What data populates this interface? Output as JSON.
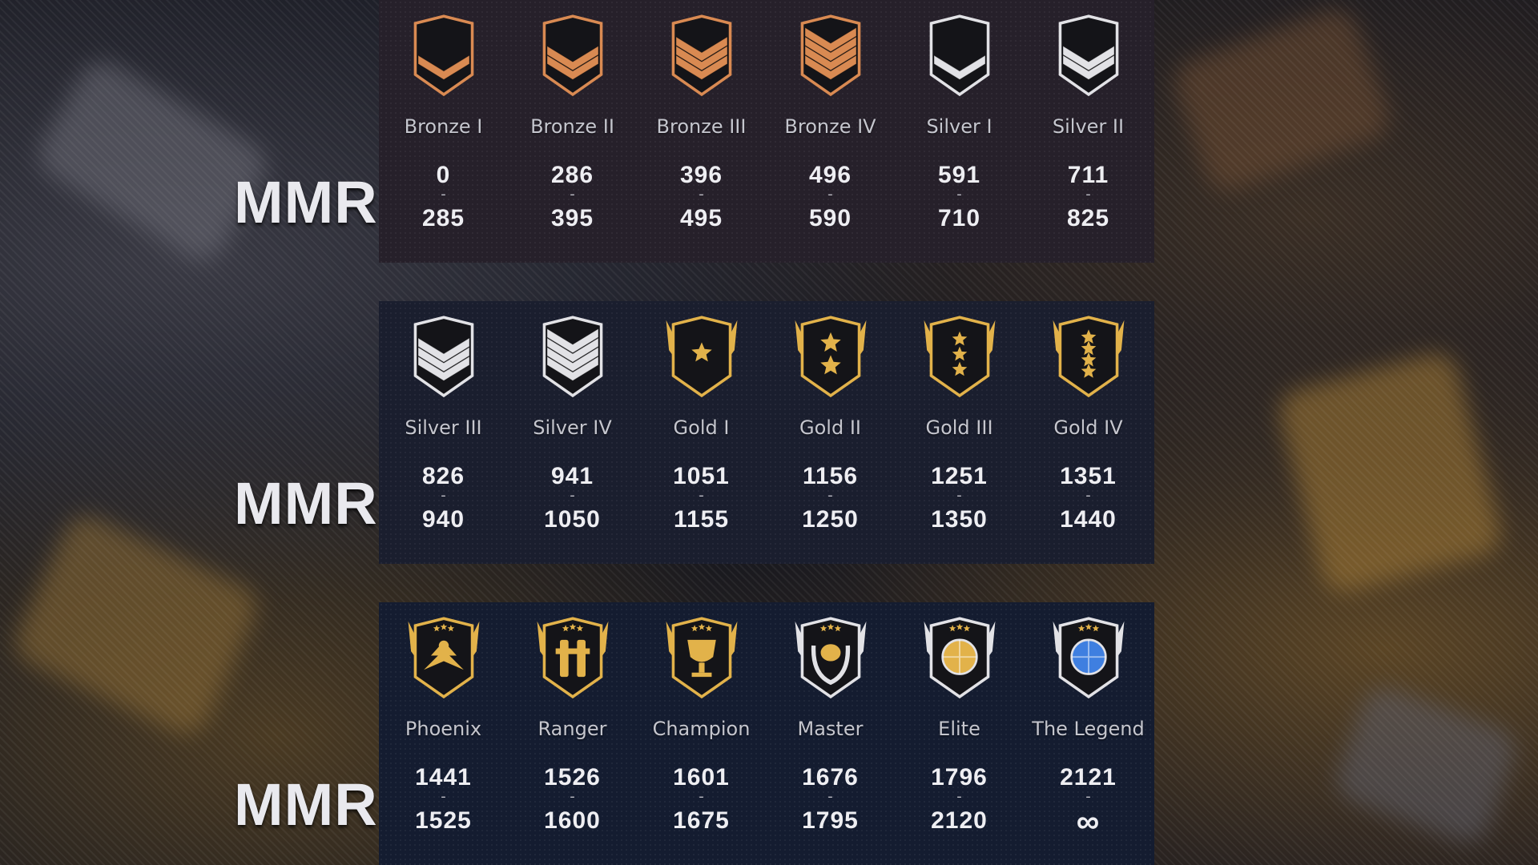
{
  "mmr_label": "MMR:",
  "range_separator": "-",
  "colors": {
    "bronze": "#d98a52",
    "silver": "#e2e2e6",
    "gold": "#e2b24a",
    "badge_dark": "#141418",
    "globe": "#3f7fe0"
  },
  "rows": [
    {
      "ranks": [
        {
          "name": "Bronze I",
          "min": "0",
          "max": "285",
          "icon": "bronze-chevron-1-icon"
        },
        {
          "name": "Bronze II",
          "min": "286",
          "max": "395",
          "icon": "bronze-chevron-2-icon"
        },
        {
          "name": "Bronze III",
          "min": "396",
          "max": "495",
          "icon": "bronze-chevron-3-icon"
        },
        {
          "name": "Bronze IV",
          "min": "496",
          "max": "590",
          "icon": "bronze-chevron-4-icon"
        },
        {
          "name": "Silver I",
          "min": "591",
          "max": "710",
          "icon": "silver-chevron-1-icon"
        },
        {
          "name": "Silver II",
          "min": "711",
          "max": "825",
          "icon": "silver-chevron-2-icon"
        }
      ]
    },
    {
      "ranks": [
        {
          "name": "Silver III",
          "min": "826",
          "max": "940",
          "icon": "silver-chevron-3-icon"
        },
        {
          "name": "Silver IV",
          "min": "941",
          "max": "1050",
          "icon": "silver-chevron-4-icon"
        },
        {
          "name": "Gold I",
          "min": "1051",
          "max": "1155",
          "icon": "gold-star-1-icon"
        },
        {
          "name": "Gold II",
          "min": "1156",
          "max": "1250",
          "icon": "gold-star-2-icon"
        },
        {
          "name": "Gold III",
          "min": "1251",
          "max": "1350",
          "icon": "gold-star-3-icon"
        },
        {
          "name": "Gold IV",
          "min": "1351",
          "max": "1440",
          "icon": "gold-star-4-icon"
        }
      ]
    },
    {
      "ranks": [
        {
          "name": "Phoenix",
          "min": "1441",
          "max": "1525",
          "icon": "phoenix-emblem-icon"
        },
        {
          "name": "Ranger",
          "min": "1526",
          "max": "1600",
          "icon": "ranger-emblem-icon"
        },
        {
          "name": "Champion",
          "min": "1601",
          "max": "1675",
          "icon": "champion-trophy-icon"
        },
        {
          "name": "Master",
          "min": "1676",
          "max": "1795",
          "icon": "master-laurel-icon"
        },
        {
          "name": "Elite",
          "min": "1796",
          "max": "2120",
          "icon": "elite-globe-icon"
        },
        {
          "name": "The Legend",
          "min": "2121",
          "max": "∞",
          "icon": "legend-globe-icon"
        }
      ]
    }
  ]
}
